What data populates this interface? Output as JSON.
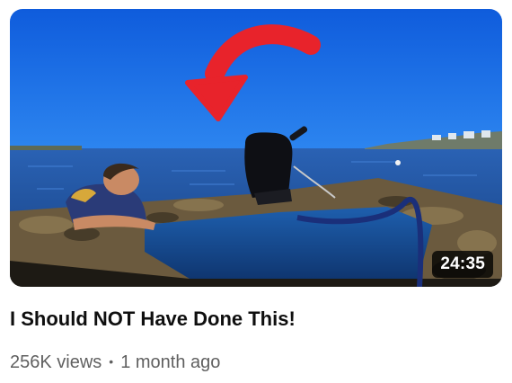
{
  "video": {
    "title": "I Should NOT Have Done This!",
    "duration": "24:35",
    "views": "256K views",
    "separator": "•",
    "age": "1 month ago"
  },
  "colors": {
    "sky": "#1464e6",
    "water": "#1f4f9c",
    "arrow": "#e8232b",
    "title_text": "#0f0f0f",
    "meta_text": "#606060"
  },
  "icons": {
    "arrow": "curved-arrow-icon"
  }
}
